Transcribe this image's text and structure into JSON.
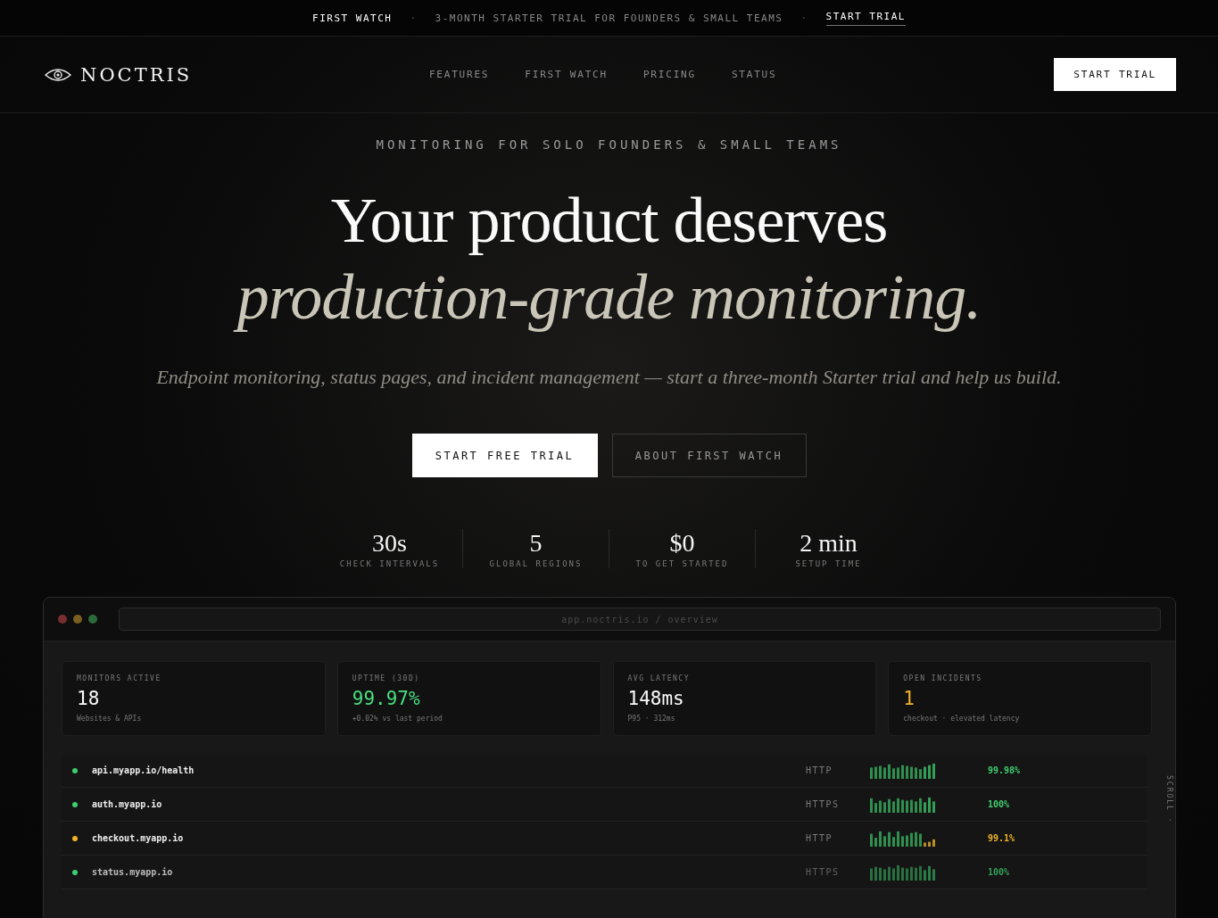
{
  "announcement": {
    "label": "FIRST WATCH",
    "message": "3-MONTH STARTER TRIAL FOR FOUNDERS & SMALL TEAMS",
    "link": "START TRIAL",
    "separator": "·"
  },
  "nav": {
    "brand": "NOCTRIS",
    "links": [
      "FEATURES",
      "FIRST WATCH",
      "PRICING",
      "STATUS"
    ],
    "cta": "START TRIAL"
  },
  "hero": {
    "eyebrow": "MONITORING FOR SOLO FOUNDERS & SMALL TEAMS",
    "headline": "Your product deserves",
    "headline_italic": "production-grade monitoring.",
    "subtitle": "Endpoint monitoring, status pages, and incident management — start a three-month Starter trial and help us build.",
    "primary_button": "START FREE TRIAL",
    "secondary_button": "ABOUT FIRST WATCH"
  },
  "stats": [
    {
      "value": "30s",
      "label": "CHECK INTERVALS"
    },
    {
      "value": "5",
      "label": "GLOBAL REGIONS"
    },
    {
      "value": "$0",
      "label": "TO GET STARTED"
    },
    {
      "value": "2 min",
      "label": "SETUP TIME"
    }
  ],
  "app_preview": {
    "url": "app.noctris.io / overview",
    "scroll_hint": "SCROLL ·",
    "metrics": [
      {
        "label": "MONITORS ACTIVE",
        "value": "18",
        "note": "Websites & APIs",
        "kind": "neutral"
      },
      {
        "label": "UPTIME (30D)",
        "value": "99.97%",
        "note": "+0.02% vs last period",
        "kind": "good"
      },
      {
        "label": "AVG LATENCY",
        "value": "148ms",
        "note": "P95 · 312ms",
        "kind": "neutral"
      },
      {
        "label": "OPEN INCIDENTS",
        "value": "1",
        "note": "checkout · elevated latency",
        "kind": "warn"
      }
    ],
    "monitors": [
      {
        "name": "api.myapp.io/health",
        "protocol": "HTTP",
        "uptime": "99.98%",
        "color": "#3ecf6e"
      },
      {
        "name": "auth.myapp.io",
        "protocol": "HTTPS",
        "uptime": "100%",
        "color": "#3ecf6e"
      },
      {
        "name": "checkout.myapp.io",
        "protocol": "HTTP",
        "uptime": "99.1%",
        "color": "#f0b429"
      },
      {
        "name": "status.myapp.io",
        "protocol": "HTTPS",
        "uptime": "100%",
        "color": "#3ecf6e"
      }
    ]
  }
}
